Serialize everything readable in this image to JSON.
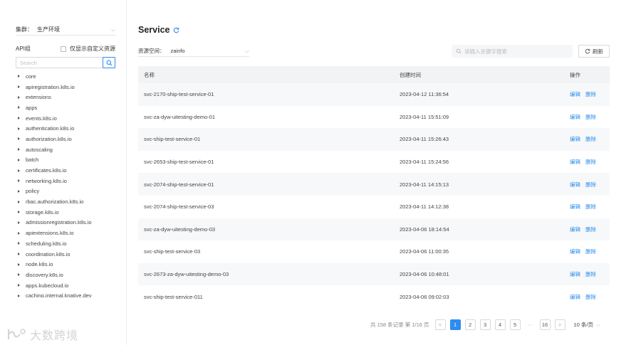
{
  "sidebar": {
    "cluster_label": "集群：",
    "cluster_value": "生产环境",
    "api_group_label": "API组",
    "show_custom_label": "仅显示自定义资源",
    "search_placeholder": "Search",
    "tree": [
      "core",
      "apiregistration.k8s.io",
      "extensions",
      "apps",
      "events.k8s.io",
      "authentication.k8s.io",
      "authorization.k8s.io",
      "autoscaling",
      "batch",
      "certificates.k8s.io",
      "networking.k8s.io",
      "policy",
      "rbac.authorization.k8s.io",
      "storage.k8s.io",
      "admissionregistration.k8s.io",
      "apiextensions.k8s.io",
      "scheduling.k8s.io",
      "coordination.k8s.io",
      "node.k8s.io",
      "discovery.k8s.io",
      "apps.kubecloud.io",
      "caching.internal.knative.dev"
    ]
  },
  "main": {
    "title": "Service",
    "namespace_label": "资源空间：",
    "namespace_value": "zainfo",
    "search_placeholder": "请输入关键字搜索",
    "refresh_label": "刷新"
  },
  "table": {
    "headers": {
      "name": "名称",
      "time": "创建时间",
      "ops": "操作"
    },
    "edit_label": "编辑",
    "delete_label": "删除",
    "rows": [
      {
        "name": "svc-2170-ship-test-service-01",
        "time": "2023-04-12 11:36:54"
      },
      {
        "name": "svc-za-dyw-uitesting-demo-01",
        "time": "2023-04-11 15:51:09"
      },
      {
        "name": "svc-ship-test-service-01",
        "time": "2023-04-11 15:26:43"
      },
      {
        "name": "svc-2653-ship-test-service-01",
        "time": "2023-04-11 15:24:56"
      },
      {
        "name": "svc-2074-ship-test-service-01",
        "time": "2023-04-11 14:15:13"
      },
      {
        "name": "svc-2074-ship-test-service-03",
        "time": "2023-04-11 14:12:38"
      },
      {
        "name": "svc-za-dyw-uitesting-demo-03",
        "time": "2023-04-06 18:14:54"
      },
      {
        "name": "svc-ship-test-service-03",
        "time": "2023-04-06 11:00:35"
      },
      {
        "name": "svc-2673-za-dyw-uitesting-demo-03",
        "time": "2023-04-06 10:48:01"
      },
      {
        "name": "svc-ship-test-service-011",
        "time": "2023-04-06 09:02:03"
      }
    ]
  },
  "pagination": {
    "summary": "共 158 条记录 第 1/16 页",
    "prev": "<",
    "pages": [
      "1",
      "2",
      "3",
      "4",
      "5"
    ],
    "ellipsis": "···",
    "last": "16",
    "next": ">",
    "page_size": "10 条/页",
    "current": "1"
  },
  "watermark": {
    "text": "大数跨境"
  },
  "colors": {
    "accent": "#2d8cf0",
    "header_bg": "#f2f3f5",
    "stripe_bg": "#f7f8fa"
  },
  "icons": [
    "chevron-down-icon",
    "search-icon",
    "refresh-icon",
    "caret-right-icon"
  ]
}
